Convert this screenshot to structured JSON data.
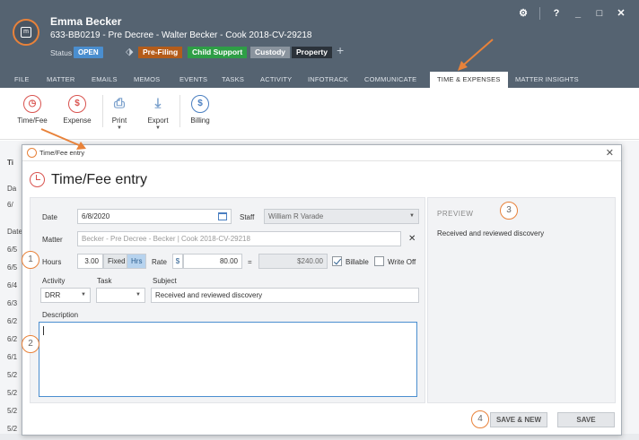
{
  "header": {
    "client_name": "Emma Becker",
    "matter_line": "633-BB0219 - Pre Decree - Walter Becker - Cook 2018-CV-29218",
    "status_label": "Status",
    "status_value": "OPEN",
    "tags": [
      "Pre-Filing",
      "Child Support",
      "Custody",
      "Property"
    ],
    "add_tag": "+",
    "window_buttons": {
      "settings": "⚙",
      "help": "?",
      "minimize": "_",
      "maximize": "□",
      "close": "✕"
    }
  },
  "menu": {
    "items": [
      "FILE",
      "MATTER",
      "EMAILS",
      "MEMOS",
      "EVENTS",
      "TASKS",
      "ACTIVITY",
      "INFOTRACK",
      "COMMUNICATE",
      "TIME & EXPENSES",
      "MATTER INSIGHTS"
    ],
    "active": "TIME & EXPENSES"
  },
  "toolbar": {
    "time_fee": "Time/Fee",
    "expense": "Expense",
    "print": "Print",
    "export": "Export",
    "billing": "Billing"
  },
  "background": {
    "tab_fragment": "Ti",
    "filter_fragment": "Da",
    "date_fragment": "6/",
    "header_fragment": "Date",
    "rows": [
      "6/5",
      "6/5",
      "6/4",
      "6/3",
      "6/2",
      "6/2",
      "6/1",
      "5/2",
      "5/2",
      "5/2",
      "5/2"
    ]
  },
  "modal": {
    "window_title": "Time/Fee entry",
    "heading": "Time/Fee entry",
    "form": {
      "date_label": "Date",
      "date_value": "6/8/2020",
      "staff_label": "Staff",
      "staff_value": "William R Varade",
      "matter_label": "Matter",
      "matter_value": "Becker - Pre Decree - Becker | Cook 2018-CV-29218",
      "hours_label": "Hours",
      "hours_value": "3.00",
      "fixed_label": "Fixed",
      "hrs_label": "Hrs",
      "rate_label": "Rate",
      "currency": "$",
      "rate_value": "80.00",
      "equals": "=",
      "total_value": "$240.00",
      "billable_label": "Billable",
      "billable_checked": true,
      "writeoff_label": "Write Off",
      "writeoff_checked": false,
      "activity_label": "Activity",
      "activity_value": "DRR",
      "task_label": "Task",
      "task_value": "",
      "subject_label": "Subject",
      "subject_value": "Received and reviewed discovery",
      "description_label": "Description",
      "description_value": ""
    },
    "preview": {
      "heading": "PREVIEW",
      "text": "Received and reviewed discovery"
    },
    "buttons": {
      "save_new": "SAVE & NEW",
      "save": "SAVE"
    },
    "close": "✕"
  },
  "callouts": [
    "1",
    "2",
    "3",
    "4"
  ],
  "colors": {
    "header_bg": "#556371",
    "accent_orange": "#e8823a",
    "status_blue": "#4a8ecf",
    "tag_prefiling": "#b45c1a",
    "tag_child_support": "#2e9e46",
    "tag_custody": "#8a949e",
    "tag_property": "#2b323a"
  }
}
